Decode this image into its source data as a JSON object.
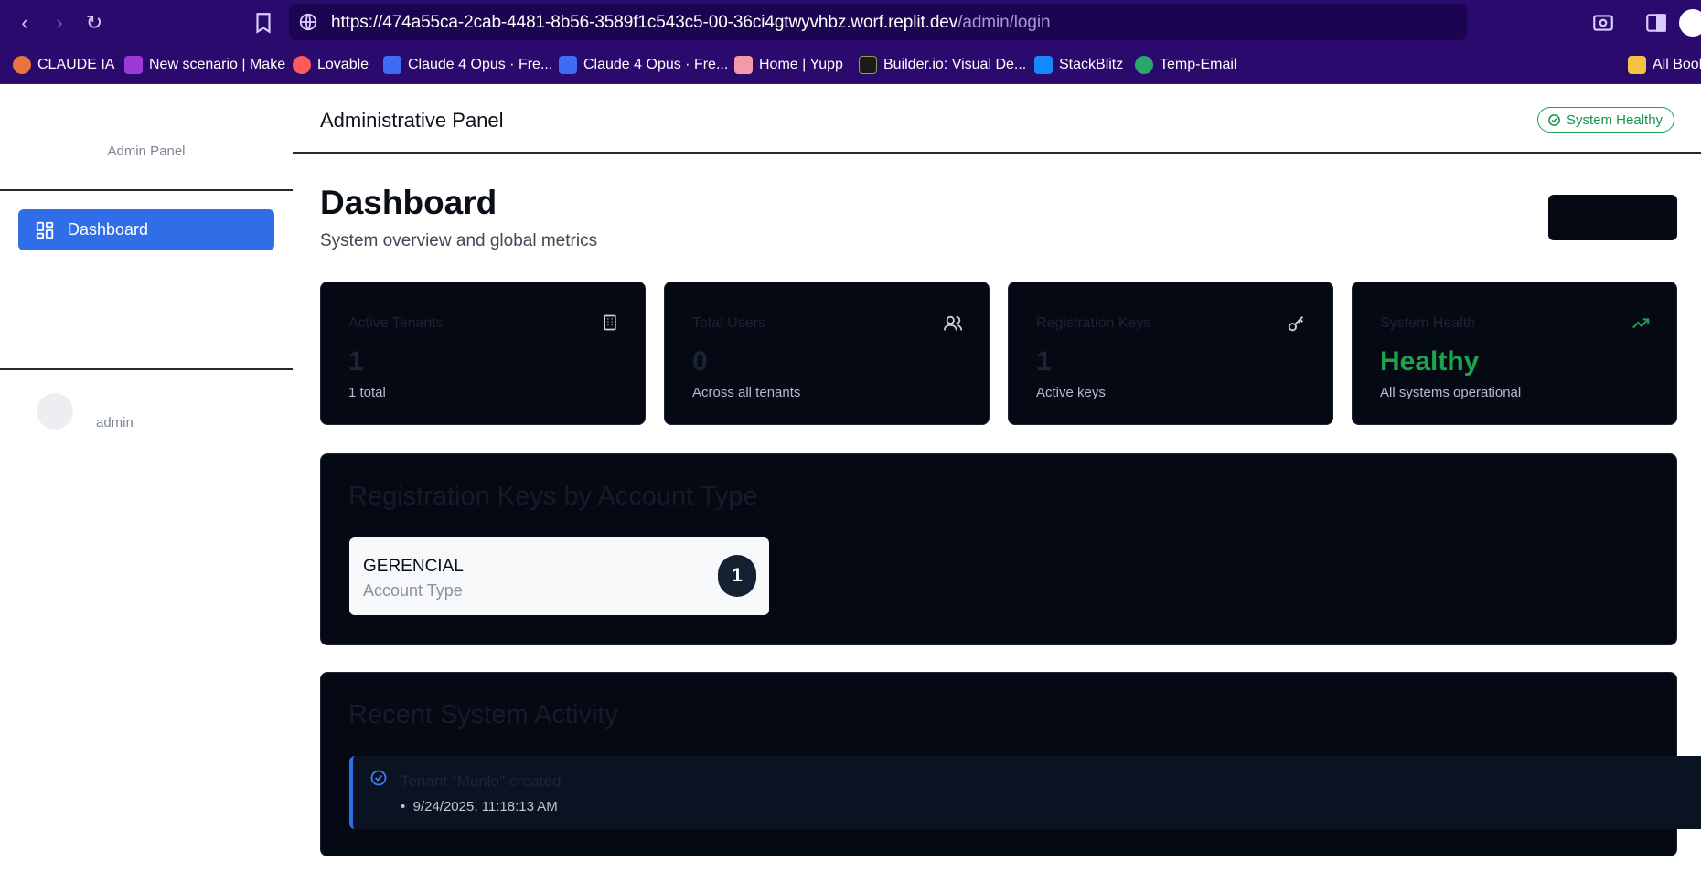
{
  "browser": {
    "url_host": "https://474a55ca-2cab-4481-8b56-3589f1c543c5-00-36ci4gtwyvhbz.worf.replit.dev",
    "url_path": "/admin/login",
    "bookmarks": [
      {
        "label": "CLAUDE IA",
        "color": "#e8733c"
      },
      {
        "label": "New scenario | Make",
        "color": "#9b3ad8"
      },
      {
        "label": "Lovable",
        "color": "#ff5a5a"
      },
      {
        "label": "Claude 4 Opus · Fre...",
        "color": "#3f6bf5"
      },
      {
        "label": "Claude 4 Opus · Fre...",
        "color": "#3f6bf5"
      },
      {
        "label": "Home | Yupp",
        "color": "#f29aa7"
      },
      {
        "label": "Builder.io: Visual De...",
        "color": "#1b1b1b"
      },
      {
        "label": "StackBlitz",
        "color": "#1389fd"
      },
      {
        "label": "Temp-Email",
        "color": "#2aa86b"
      },
      {
        "label": "All Book",
        "color": "#f5c242"
      }
    ]
  },
  "sidebar": {
    "brand": "Admin Panel",
    "nav": [
      {
        "label": "Dashboard",
        "icon": "grid-icon"
      }
    ],
    "user": "admin"
  },
  "header": {
    "title": "Administrative Panel",
    "status_badge": "System Healthy"
  },
  "page": {
    "title": "Dashboard",
    "subtitle": "System overview and global metrics"
  },
  "stats": [
    {
      "label": "Active Tenants",
      "value": "1",
      "sub": "1 total",
      "icon": "building-icon"
    },
    {
      "label": "Total Users",
      "value": "0",
      "sub": "Across all tenants",
      "icon": "users-icon"
    },
    {
      "label": "Registration Keys",
      "value": "1",
      "sub": "Active keys",
      "icon": "key-icon"
    },
    {
      "label": "System Health",
      "value": "Healthy",
      "sub": "All systems operational",
      "icon": "trending-up-icon"
    }
  ],
  "registration_keys": {
    "title": "Registration Keys by Account Type",
    "items": [
      {
        "name": "GERENCIAL",
        "type": "Account Type",
        "count": "1"
      }
    ]
  },
  "activity": {
    "title": "Recent System Activity",
    "items": [
      {
        "text": "Tenant \"Murilo\" created",
        "time": "9/24/2025, 11:18:13 AM"
      }
    ]
  },
  "colors": {
    "accent": "#2f6ee6",
    "healthy": "#1fa24d",
    "card_bg": "#050914"
  }
}
